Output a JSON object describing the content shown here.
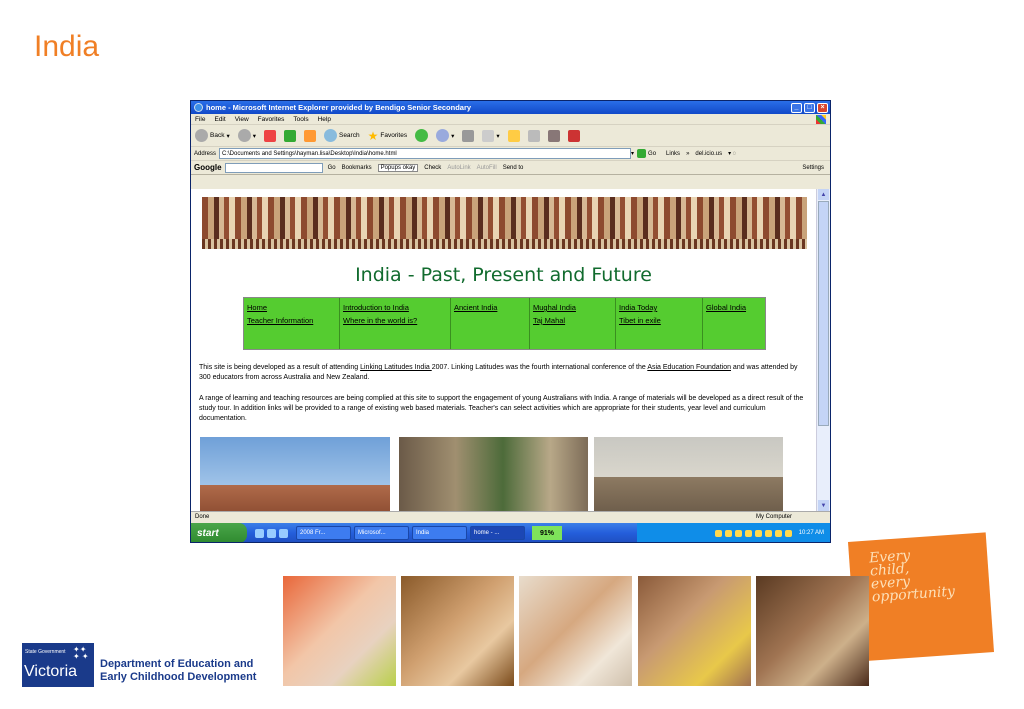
{
  "slide": {
    "title": "India"
  },
  "browser": {
    "title": "home - Microsoft Internet Explorer provided by Bendigo Senior Secondary",
    "menu": [
      "File",
      "Edit",
      "View",
      "Favorites",
      "Tools",
      "Help"
    ],
    "toolbar": {
      "back": "Back",
      "search": "Search",
      "favorites": "Favorites"
    },
    "address_label": "Address",
    "address": "C:\\Documents and Settings\\hayman.lisa\\Desktop\\India\\home.html",
    "go": "Go",
    "links": "Links",
    "delicious": "del.icio.us",
    "google": {
      "logo": "Google",
      "go": "Go",
      "bookmarks": "Bookmarks",
      "popups": "Popups okay",
      "check": "Check",
      "autolink": "AutoLink",
      "autofill": "AutoFill",
      "sendto": "Send to",
      "settings": "Settings"
    },
    "status": "Done",
    "zone": "My Computer"
  },
  "page": {
    "title": "India - Past, Present and Future",
    "nav": [
      {
        "items": [
          "Home",
          "Teacher Information"
        ]
      },
      {
        "items": [
          "Introduction to India",
          "Where in the world is?"
        ]
      },
      {
        "items": [
          "Ancient India"
        ]
      },
      {
        "items": [
          "Mughal India",
          "Taj Mahal"
        ]
      },
      {
        "items": [
          "India Today",
          "Tibet in exile"
        ]
      },
      {
        "items": [
          "Global India"
        ]
      }
    ],
    "para1": {
      "a": "This site is being developed as a result of attending ",
      "link1": "Linking Latitudes India ",
      "b": "2007. Linking Latitudes was the fourth international conference of the ",
      "link2": "Asia Education Foundation",
      "c": " and was attended by 300 educators from across Australia and New Zealand."
    },
    "para2": "A range of learning and teaching resources are being complied at this site to support the engagement of young Australians with India. A range of materials will be developed as a direct result of the study tour. In addition links will be provided to a range of existing web based materials. Teacher's can select activities which are appropriate for their students, year level and curriculum documentation."
  },
  "taskbar": {
    "start": "start",
    "tasks": [
      "2008 Fr...",
      "Microsof...",
      "India",
      "home - ..."
    ],
    "percent": "91%",
    "clock": "10:27 AM"
  },
  "tagline": [
    "Every",
    "child,",
    "every",
    "opportunity"
  ],
  "footer": {
    "sg": "State Government",
    "victoria": "Victoria",
    "dept_line1": "Department of Education and",
    "dept_line2": "Early Childhood Development"
  },
  "colors": {
    "accent_orange": "#f07f25",
    "nav_green": "#55cc30",
    "title_green": "#116b2e",
    "vic_blue": "#1a3a8a"
  }
}
